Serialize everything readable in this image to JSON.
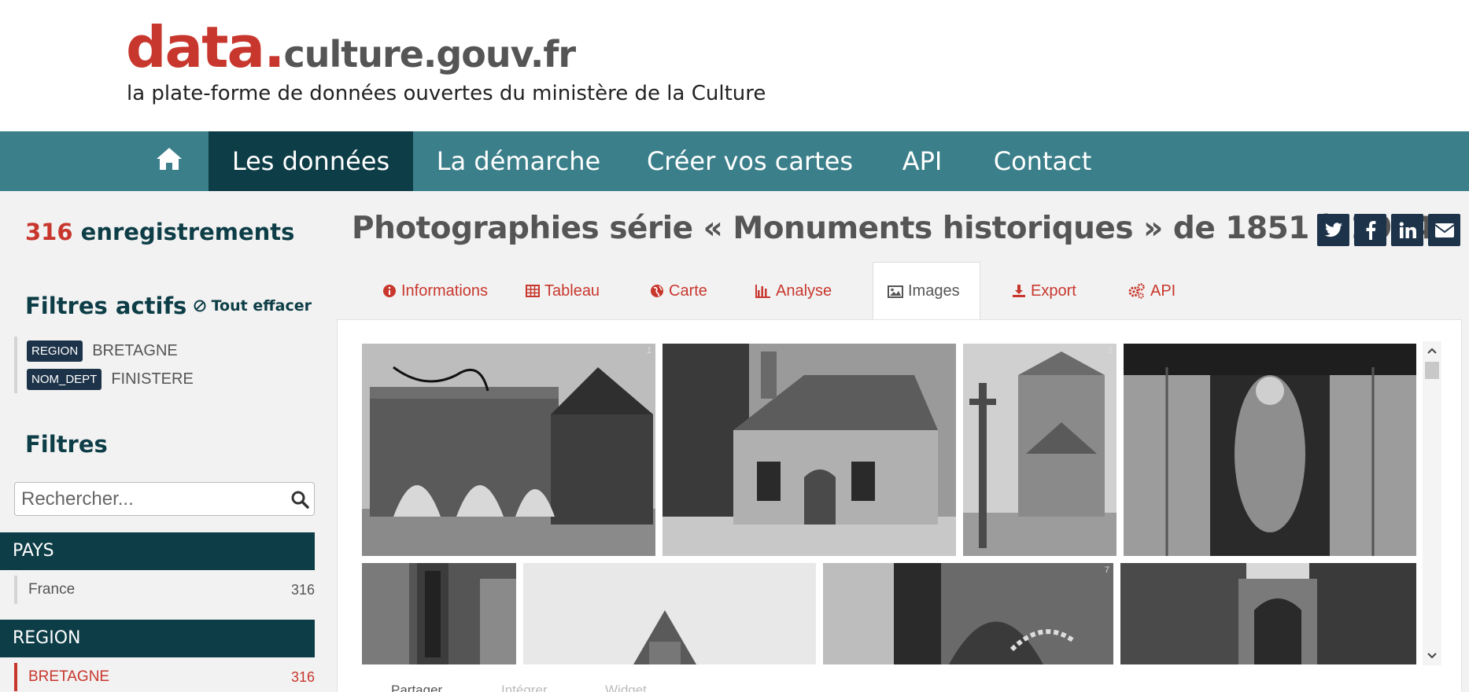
{
  "header": {
    "logo_data": "data.",
    "logo_domain": "culture.gouv.fr",
    "tagline": "la plate-forme de données ouvertes du ministère de la Culture"
  },
  "nav": {
    "home_icon": "home-icon",
    "items": [
      {
        "label": "Les données",
        "active": true
      },
      {
        "label": "La démarche",
        "active": false
      },
      {
        "label": "Créer vos cartes",
        "active": false
      },
      {
        "label": "API",
        "active": false
      },
      {
        "label": "Contact",
        "active": false
      }
    ]
  },
  "sidebar": {
    "count": "316",
    "count_label": "enregistrements",
    "active_filters_title": "Filtres actifs",
    "clear_all": "Tout effacer",
    "active_filters": [
      {
        "tag": "REGION",
        "value": "BRETAGNE"
      },
      {
        "tag": "NOM_DEPT",
        "value": "FINISTERE"
      }
    ],
    "filters_title": "Filtres",
    "search_placeholder": "Rechercher...",
    "facets": [
      {
        "title": "PAYS",
        "items": [
          {
            "label": "France",
            "count": "316",
            "selected": false
          }
        ]
      },
      {
        "title": "REGION",
        "items": [
          {
            "label": "BRETAGNE",
            "count": "316",
            "selected": true
          }
        ]
      }
    ]
  },
  "main": {
    "title": "Photographies série « Monuments historiques » de 1851 à 1914",
    "share_icons": [
      "twitter-icon",
      "facebook-icon",
      "linkedin-icon",
      "email-icon"
    ],
    "tabs": [
      {
        "label": "Informations",
        "icon": "info-circle-icon",
        "active": false
      },
      {
        "label": "Tableau",
        "icon": "table-icon",
        "active": false
      },
      {
        "label": "Carte",
        "icon": "globe-icon",
        "active": false
      },
      {
        "label": "Analyse",
        "icon": "bar-chart-icon",
        "active": false
      },
      {
        "label": "Images",
        "icon": "image-icon",
        "active": true
      },
      {
        "label": "Export",
        "icon": "download-icon",
        "active": false
      },
      {
        "label": "API",
        "icon": "cogs-icon",
        "active": false
      }
    ],
    "gallery_numbers": [
      "1",
      "3",
      "7"
    ],
    "bottom_tabs": [
      "Partager",
      "Intégrer",
      "Widget"
    ],
    "colors": {
      "accent": "#c8372d",
      "nav": "#3b7f8a",
      "dark": "#0d3d47",
      "tag": "#1d3349"
    }
  }
}
